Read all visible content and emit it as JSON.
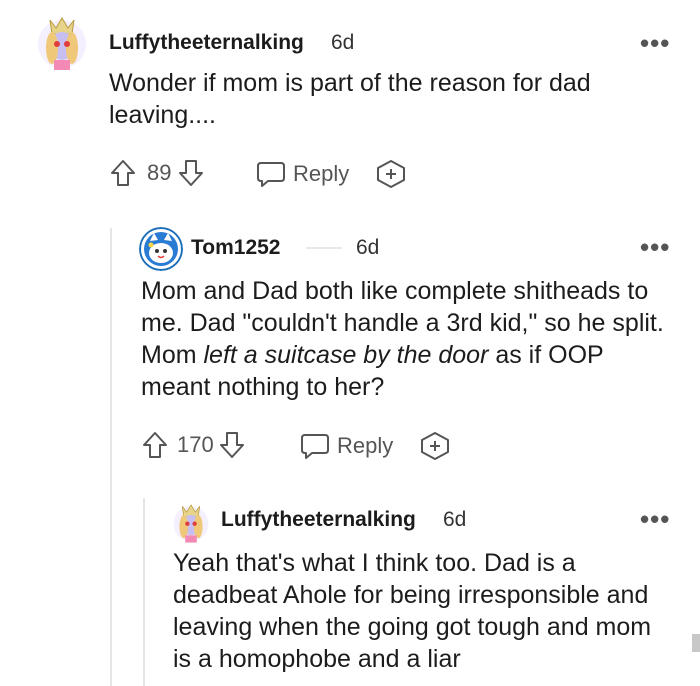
{
  "comments": [
    {
      "username": "Luffytheeternalking",
      "age": "6d",
      "text": "Wonder if mom is part of the reason for dad leaving....",
      "score": "89",
      "reply_label": "Reply"
    },
    {
      "username": "Tom1252",
      "age": "6d",
      "text_before": "Mom and Dad both like complete shitheads to me. Dad \"couldn't handle a 3rd kid,\" so he split. Mom ",
      "text_italic": "left a suitcase by the door",
      "text_after": " as if OOP meant nothing to her?",
      "score": "170",
      "reply_label": "Reply"
    },
    {
      "username": "Luffytheeternalking",
      "age": "6d",
      "text": "Yeah that's what I think too. Dad is a deadbeat Ahole for being irresponsible and leaving when the going got tough and mom is a homophobe and a liar"
    }
  ],
  "more_label": "•••"
}
